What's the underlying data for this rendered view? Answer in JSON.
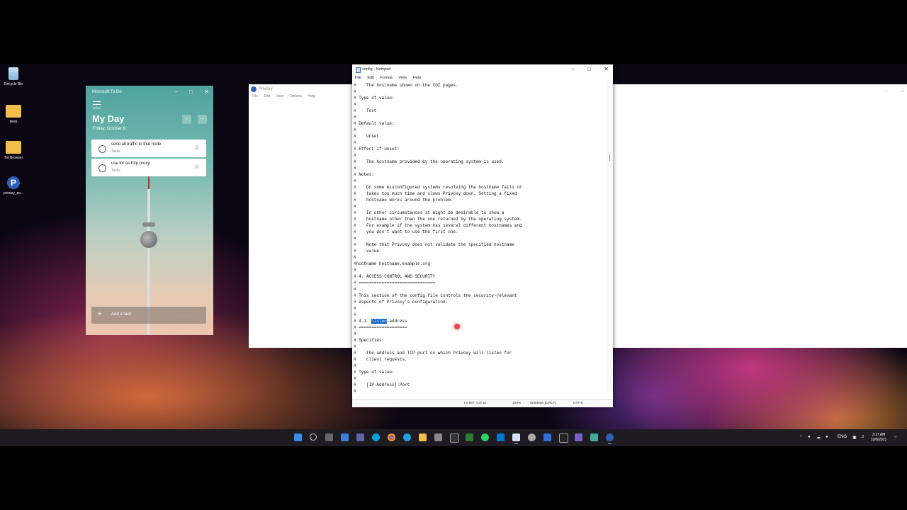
{
  "desktop": {
    "icons": [
      {
        "label": "Recycle Bin"
      },
      {
        "label": "desk"
      },
      {
        "label": "Tor Browser"
      },
      {
        "label": "privoxy_se..."
      }
    ]
  },
  "privoxy_window": {
    "title": "Privoxy",
    "menu": [
      "File",
      "Edit",
      "View",
      "Options",
      "Help"
    ]
  },
  "todo": {
    "window_title": "Microsoft To Do",
    "heading": "My Day",
    "date": "Friday, October 8",
    "tasks": [
      {
        "title": "send all traffic to that node",
        "list": "Tasks"
      },
      {
        "title": "use tor as http proxy",
        "list": "Tasks"
      }
    ],
    "add_task": "Add a task",
    "suggestions_icon": "lightbulb-icon",
    "more_icon": "more-icon"
  },
  "notepad": {
    "title": "config - Notepad",
    "menu": [
      "File",
      "Edit",
      "Format",
      "View",
      "Help"
    ],
    "lines": [
      "#    The hostname shown on the CGI pages.",
      "#",
      "# Type of value:",
      "#",
      "#    Text",
      "#",
      "# Default value:",
      "#",
      "#    Unset",
      "#",
      "# Effect if unset:",
      "#",
      "#    The hostname provided by the operating system is used.",
      "#",
      "# Notes:",
      "#",
      "#    On some misconfigured systems resolving the hostname fails or",
      "#    takes too much time and slows Privoxy down. Setting a fixed",
      "#    hostname works around the problem.",
      "#",
      "#    In other circumstances it might be desirable to show a",
      "#    hostname other than the one returned by the operating system.",
      "#    For example if the system has several different hostnames and",
      "#    you don't want to use the first one.",
      "#",
      "#    Note that Privoxy does not validate the specified hostname",
      "#    value.",
      "#",
      "#hostname hostname.example.org",
      "#",
      "# 4. ACCESS CONTROL AND SECURITY",
      "# ==============================",
      "#",
      "# This section of the config file controls the security-relevant",
      "# aspects of Privoxy's configuration.",
      "#",
      "#",
      "# 4.1. listen-address",
      "# ===================",
      "#",
      "# Specifies:",
      "#",
      "#    The address and TCP port on which Privoxy will listen for",
      "#    client requests.",
      "#",
      "# Type of value:",
      "#",
      "#    [IP-Address]:Port",
      "#"
    ],
    "highlight": {
      "before": "# 4.1. ",
      "selected": "listen",
      "after": "-address"
    },
    "status": {
      "position": "Ln 687, Col 15",
      "zoom": "100%",
      "line_endings": "Windows (CRLF)",
      "encoding": "UTF-8"
    }
  },
  "taskbar": {
    "language": "ENG",
    "time": "3:17 AM",
    "date": "10/8/2021"
  }
}
